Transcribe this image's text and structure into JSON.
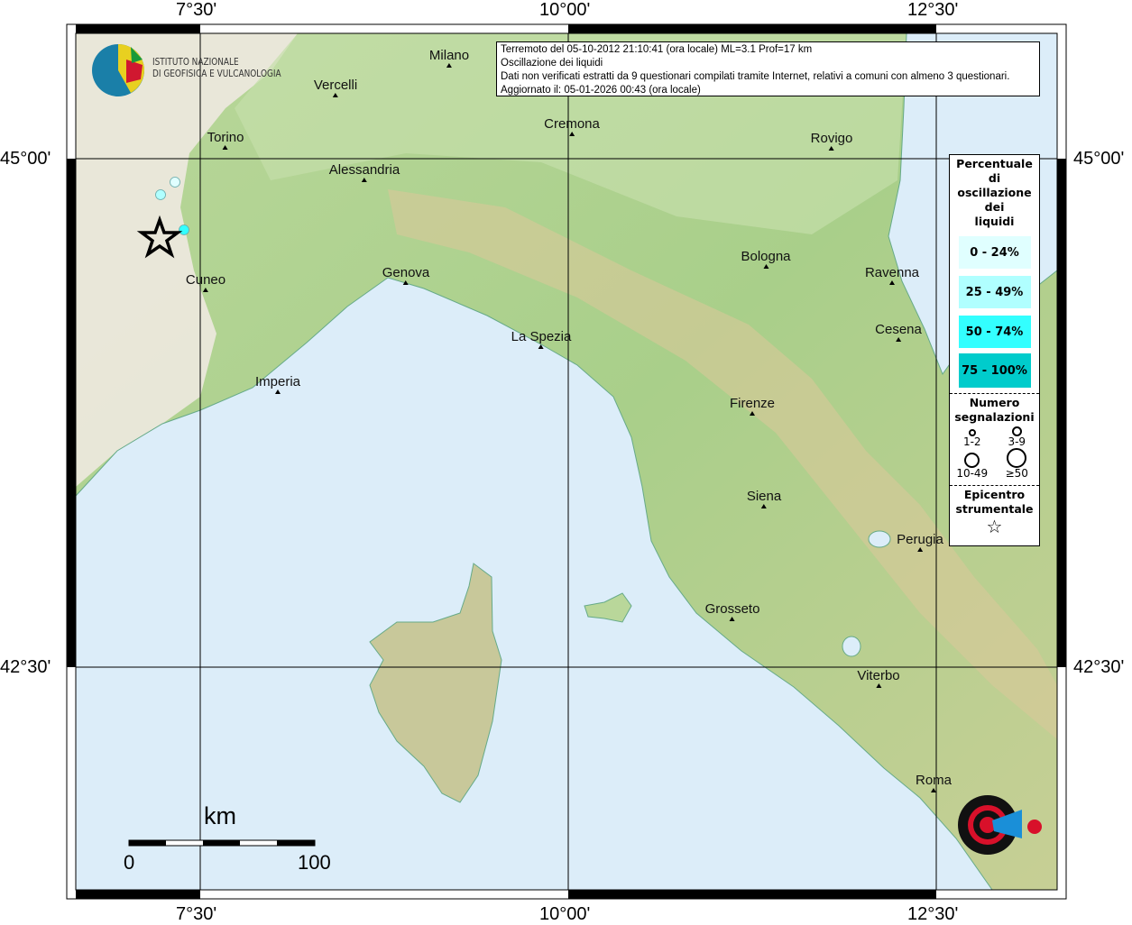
{
  "info": {
    "line1": "Terremoto del 05-10-2012 21:10:41 (ora locale) ML=3.1 Prof=17 km",
    "line2": "Oscillazione dei liquidi",
    "line3": "Dati non verificati estratti da 9 questionari compilati tramite Internet, relativi a comuni con almeno 3 questionari.",
    "line4": "Aggiornato il: 05-01-2026 00:43 (ora locale)"
  },
  "axes": {
    "lon": [
      "7°30'",
      "10°00'",
      "12°30'"
    ],
    "lat": [
      "45°00'",
      "42°30'"
    ]
  },
  "logo_ingv": {
    "line1": "ISTITUTO NAZIONALE",
    "line2": "DI GEOFISICA E VULCANOLOGIA"
  },
  "logo_hsit": "www.haisentitoilterremoto.it",
  "cities": [
    "Milano",
    "Vercelli",
    "Torino",
    "Cremona",
    "Rovigo",
    "Alessandria",
    "Cuneo",
    "Genova",
    "Bologna",
    "Ravenna",
    "La Spezia",
    "Cesena",
    "Imperia",
    "Firenze",
    "Siena",
    "Perugia",
    "Grosseto",
    "Viterbo",
    "Roma"
  ],
  "legend": {
    "title": [
      "Percentuale",
      "di",
      "oscillazione",
      "dei",
      "liquidi"
    ],
    "classes": [
      {
        "label": "0 - 24%",
        "color": "#e0ffff"
      },
      {
        "label": "25 - 49%",
        "color": "#b0ffff"
      },
      {
        "label": "50 - 74%",
        "color": "#33ffff"
      },
      {
        "label": "75 - 100%",
        "color": "#00cccc"
      }
    ],
    "count_title": [
      "Numero",
      "segnalazioni"
    ],
    "counts": [
      "1-2",
      "3-9",
      "10-49",
      "≥50"
    ],
    "epicenter_title": [
      "Epicentro",
      "strumentale"
    ]
  },
  "observations": [
    {
      "class": 0,
      "count": "3-9"
    },
    {
      "class": 1,
      "count": "3-9"
    },
    {
      "class": 2,
      "count": "3-9"
    }
  ],
  "scale": {
    "unit": "km",
    "min": "0",
    "max": "100"
  }
}
